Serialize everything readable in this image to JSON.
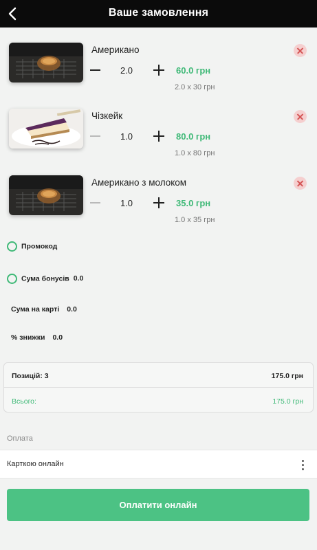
{
  "header": {
    "title": "Ваше замовлення",
    "back_icon": "back-arrow-icon"
  },
  "items": [
    {
      "name": "Американо",
      "qty": "2.0",
      "price": "60.0 грн",
      "calc": "2.0 x 30 грн",
      "minus_enabled": true
    },
    {
      "name": "Чізкейк",
      "qty": "1.0",
      "price": "80.0 грн",
      "calc": "1.0 x 80 грн",
      "minus_enabled": false
    },
    {
      "name": "Американо з молоком",
      "qty": "1.0",
      "price": "35.0 грн",
      "calc": "1.0 x 35 грн",
      "minus_enabled": false
    }
  ],
  "options": {
    "promo_label": "Промокод",
    "bonus_label": "Сума бонусів",
    "bonus_value": "0.0",
    "card_label": "Сума на карті",
    "card_value": "0.0",
    "discount_label": "% знижки",
    "discount_value": "0.0"
  },
  "summary": {
    "positions_label": "Позицій: 3",
    "positions_amount": "175.0 грн",
    "total_label": "Всього:",
    "total_amount": "175.0 грн"
  },
  "payment": {
    "section_label": "Оплата",
    "method": "Карткою онлайн",
    "button_label": "Оплатити онлайн"
  },
  "colors": {
    "accent": "#4cc284",
    "price": "#3fb977",
    "remove_bg": "#f5cfcf",
    "remove_x": "#d45555",
    "header_bg": "#0b0b0b"
  }
}
